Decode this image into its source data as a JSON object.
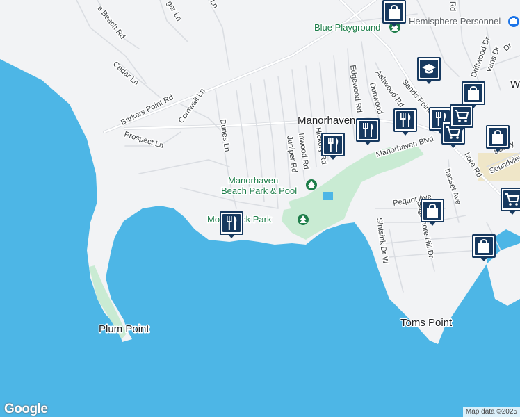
{
  "map": {
    "colors": {
      "water": "#4db6e6",
      "land": "#f2f3f5",
      "park": "#c9ebd3",
      "road": "#ffffff",
      "road_casing": "#d6d9de",
      "pin_border": "#17395f"
    },
    "places": {
      "town": "Manorhaven",
      "plum_point": "Plum Point",
      "toms_point": "Toms Point",
      "partial_town": "W"
    },
    "parks": {
      "beach_park_line1": "Manorhaven",
      "beach_park_line2": "Beach Park & Pool",
      "dock_park": "Mo    Dock Park"
    },
    "pois": {
      "blue_playground": "Blue Playground",
      "hemisphere": "Hemisphere Personnel"
    },
    "roads": {
      "beach_rd": "s Beach Rd",
      "ger_ln": "ger Ln",
      "ln_top": "Ln",
      "rd_top": "Rd",
      "cedar_ln": "Cedar Ln",
      "barkers_point_rd": "Barkers Point Rd",
      "cornwall_ln": "Cornwall Ln",
      "prospect_ln": "Prospect Ln",
      "dunes_ln": "Dunes Ln",
      "juniper_rd": "Juniper Rd",
      "inwood_rd": "Inwood Rd",
      "hickory_rd": "Hickory Rd",
      "edgewood_rd": "Edgewood Rd",
      "dunwood": "Dunwood",
      "ashwood_rd": "Ashwood Rd",
      "sands_point": "Sands Point",
      "manorhaven_blvd": "Manorhaven Blvd",
      "shore_rd": "hore Rd",
      "driftwood_dr": "Driftwood Dr",
      "evans_dr": "vans Dr",
      "sandy": "Sandy",
      "soundview": "Soundview",
      "pequot_ave": "Pequot Ave",
      "sintsink_dr_w": "Sintsink Dr W",
      "sagamore_hill_dr": "Sagamore Hill Dr",
      "chasset_ave": "hasset Ave",
      "dr_right": "Dr"
    },
    "markers": [
      {
        "icon": "restaurant-icon"
      },
      {
        "icon": "restaurant-icon"
      },
      {
        "icon": "restaurant-icon"
      },
      {
        "icon": "restaurant-icon"
      },
      {
        "icon": "restaurant-icon"
      },
      {
        "icon": "school-icon"
      },
      {
        "icon": "shopping-bag-icon"
      },
      {
        "icon": "shopping-bag-icon"
      },
      {
        "icon": "shopping-bag-icon"
      },
      {
        "icon": "shopping-bag-icon"
      },
      {
        "icon": "shopping-bag-icon"
      },
      {
        "icon": "shopping-cart-icon"
      },
      {
        "icon": "shopping-cart-icon"
      },
      {
        "icon": "shopping-cart-icon"
      }
    ],
    "logo": "Google",
    "attribution": "Map data ©2025"
  }
}
